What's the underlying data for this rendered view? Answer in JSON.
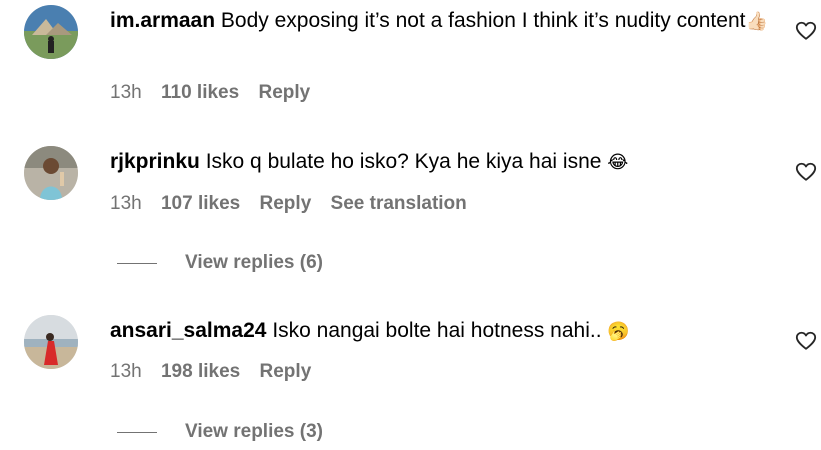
{
  "comments": [
    {
      "username": "im.armaan",
      "text": "Body exposing it’s not a fashion I think it’s nudity content",
      "emoji": "👍🏻",
      "time": "13h",
      "likes": "110 likes",
      "reply": "Reply"
    },
    {
      "username": "rjkprinku",
      "text": "Isko q bulate ho isko? Kya he kiya hai isne",
      "emoji": "😂",
      "time": "13h",
      "likes": "107 likes",
      "reply": "Reply",
      "translation": "See translation",
      "view_replies": "View replies (6)"
    },
    {
      "username": "ansari_salma24",
      "text": "Isko nangai bolte hai hotness nahi..",
      "emoji": "🥱",
      "time": "13h",
      "likes": "198 likes",
      "reply": "Reply",
      "view_replies": "View replies (3)"
    }
  ],
  "icons": {
    "like": "heart-outline-icon"
  },
  "colors": {
    "text": "#000000",
    "secondary": "#737373",
    "background": "#ffffff"
  }
}
